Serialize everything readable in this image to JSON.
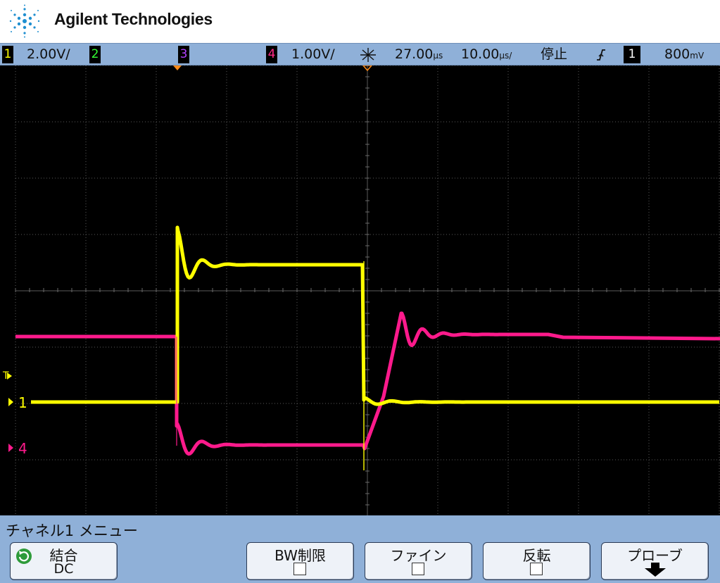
{
  "brand": {
    "name": "Agilent Technologies",
    "logo_icon": "agilent-spark-icon"
  },
  "status_bar": {
    "ch1_badge": "1",
    "ch1_scale": "2.00V/",
    "ch2_badge": "2",
    "ch3_badge": "3",
    "ch4_badge": "4",
    "ch4_scale": "1.00V/",
    "delay_icon": "horizontal-delay-icon",
    "delay": "27.00",
    "delay_unit": "µs",
    "timebase": "10.00",
    "timebase_unit": "µs/",
    "run_state": "停止",
    "trigger_edge_icon": "rising-edge-icon",
    "trigger_source": "1",
    "trigger_level": "800",
    "trigger_level_unit": "mV"
  },
  "screen": {
    "ch1_marker": "1",
    "ch4_marker": "4",
    "trigger_marker": "T",
    "colors": {
      "ch1": "#ffff00",
      "ch4": "#ff1a8c",
      "grid": "#5a5a5a",
      "background": "#000000"
    }
  },
  "menu": {
    "title": "チャネル1 メニュー",
    "softkeys": [
      {
        "label": "結合",
        "value": "DC",
        "icon": "rotate-select-icon"
      },
      {
        "label": "BW制限",
        "checked": false
      },
      {
        "label": "ファイン",
        "checked": false
      },
      {
        "label": "反転",
        "checked": false
      },
      {
        "label": "プローブ",
        "icon": "submenu-down-arrow-icon"
      }
    ]
  }
}
